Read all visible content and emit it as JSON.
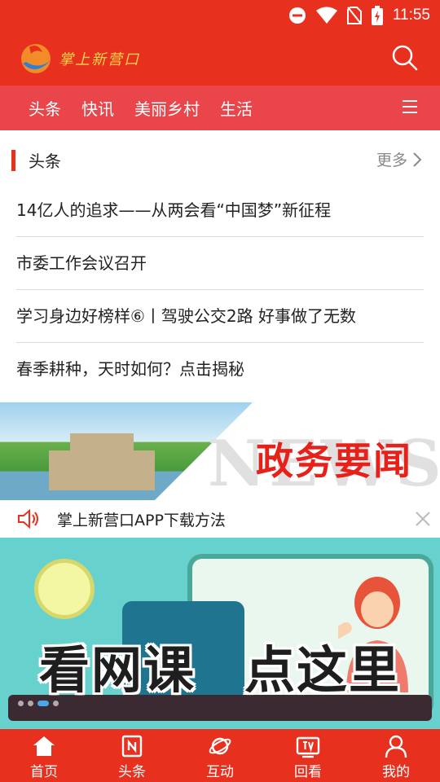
{
  "status_bar": {
    "time": "11:55"
  },
  "header": {
    "logo_text": "掌上新营口"
  },
  "nav": {
    "tabs": [
      "头条",
      "快讯",
      "美丽乡村",
      "生活"
    ]
  },
  "section": {
    "title": "头条",
    "more_label": "更多",
    "items": [
      "14亿人的追求——从两会看“中国梦”新征程",
      "市委工作会议召开",
      "学习身边好榜样⑥丨驾驶公交2路 好事做了无数",
      "春季耕种，天时如何？点击揭秘"
    ]
  },
  "banner": {
    "title": "政务要闻",
    "watermark": "NEWS"
  },
  "notice": {
    "text": "掌上新营口APP下载方法"
  },
  "ad": {
    "text_left": "看网课",
    "text_right": "点这里"
  },
  "tabbar": {
    "items": [
      {
        "label": "首页",
        "icon": "home-icon"
      },
      {
        "label": "头条",
        "icon": "news-icon"
      },
      {
        "label": "互动",
        "icon": "planet-icon"
      },
      {
        "label": "回看",
        "icon": "tv-icon"
      },
      {
        "label": "我的",
        "icon": "person-icon"
      }
    ]
  }
}
